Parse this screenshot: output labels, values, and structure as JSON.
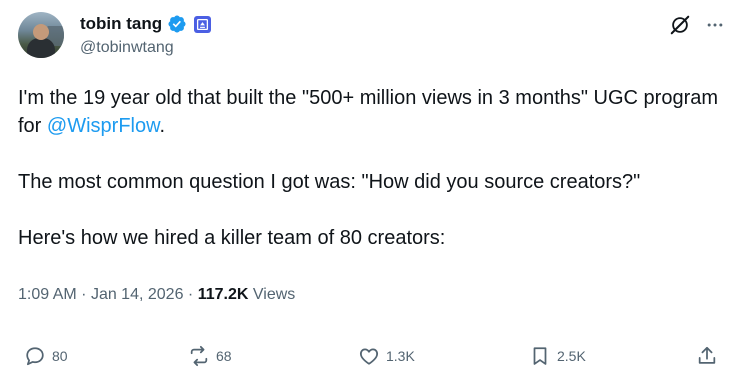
{
  "author": {
    "display_name": "tobin tang",
    "handle": "@tobinwtang",
    "verified": true,
    "affiliation_icon": "affiliate-badge-icon",
    "accent_color": "#1d9bf0"
  },
  "tweet": {
    "line1_prefix": "I'm the 19 year old that built the \"500+ million views in 3 months\" UGC program for ",
    "mention": "@WisprFlow",
    "line1_suffix": ".",
    "paragraph2": "The most common question I got was: \"How did you source creators?\"",
    "paragraph3": "Here's how we hired a killer team of 80 creators:"
  },
  "meta": {
    "time": "1:09 AM",
    "separator": "·",
    "date": "Jan 14, 2026",
    "views_count": "117.2K",
    "views_label": "Views"
  },
  "actions": {
    "replies": "80",
    "reposts": "68",
    "likes": "1.3K",
    "bookmarks": "2.5K"
  },
  "icons": {
    "top_right": [
      "grok-icon",
      "more-options-icon"
    ],
    "actions": [
      "reply-icon",
      "repost-icon",
      "like-icon",
      "bookmark-icon",
      "share-icon"
    ]
  }
}
